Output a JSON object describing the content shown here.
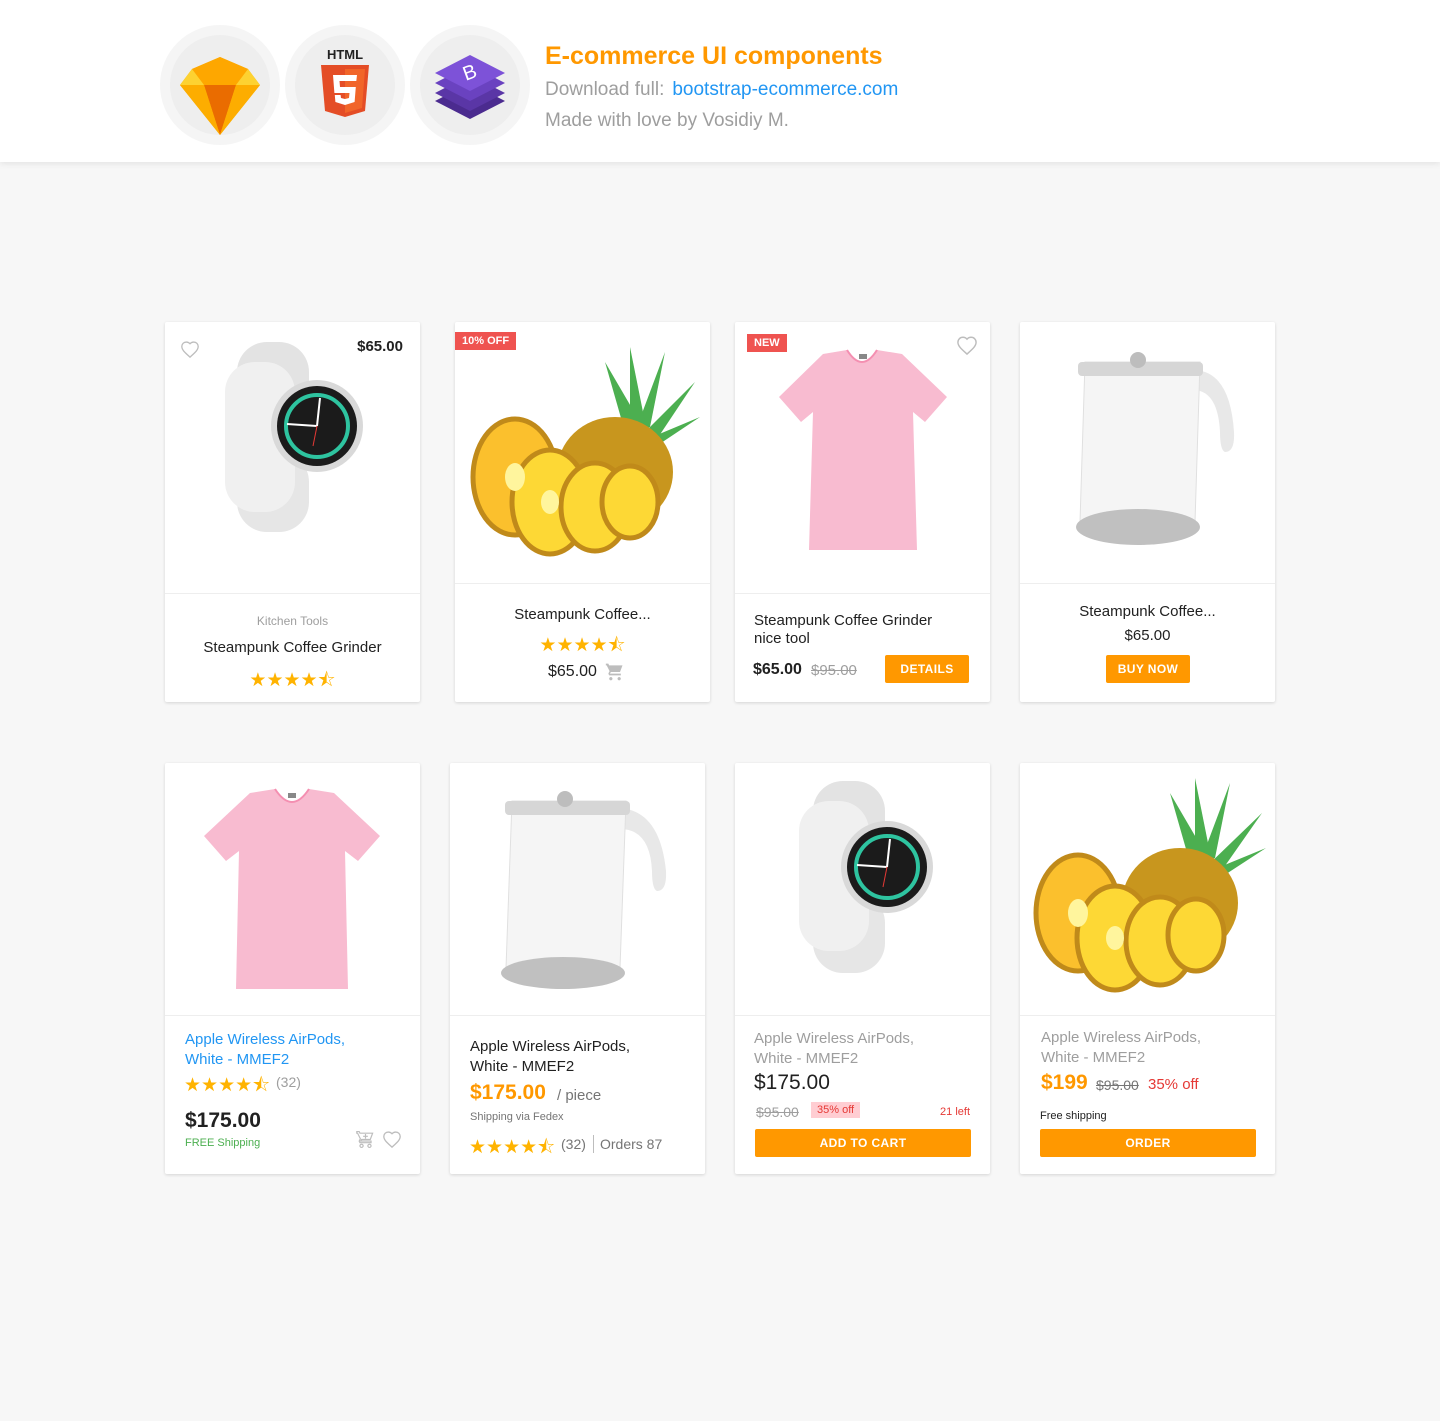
{
  "header": {
    "title": "E-commerce UI components",
    "download_label": "Download full:",
    "download_link": "bootstrap-ecommerce.com",
    "made_by": "Made with love by  Vosidiy M.",
    "html5_text": "HTML",
    "bootstrap_letter": "B"
  },
  "colors": {
    "accent": "#ff9800",
    "link": "#2196f3",
    "badge": "#ef5350",
    "star": "#ffb300",
    "success": "#4caf50",
    "danger": "#e53935"
  },
  "row1": [
    {
      "price": "$65.00",
      "category": "Kitchen Tools",
      "name": "Steampunk Coffee Grinder",
      "rating": 4.5,
      "stars": "★★★★⯪"
    },
    {
      "badge": "10% OFF",
      "name": "Steampunk Coffee...",
      "rating": 4.5,
      "stars": "★★★★⯪",
      "price": "$65.00"
    },
    {
      "badge": "NEW",
      "name_line1": "Steampunk Coffee Grinder",
      "name_line2": "nice tool",
      "price": "$65.00",
      "old_price": "$95.00",
      "button": "DETAILS"
    },
    {
      "name": "Steampunk Coffee...",
      "price": "$65.00",
      "button": "BUY NOW"
    }
  ],
  "row2": [
    {
      "name_line1": "Apple Wireless AirPods,",
      "name_line2": "White - MMEF2",
      "stars": "★★★★⯪",
      "rating": 4.5,
      "reviews": "(32)",
      "price": "$175.00",
      "shipping": "FREE Shipping"
    },
    {
      "name_line1": "Apple Wireless AirPods,",
      "name_line2": "White - MMEF2",
      "price": "$175.00",
      "unit": "/ piece",
      "shipping": "Shipping via Fedex",
      "stars": "★★★★⯪",
      "rating": 4.5,
      "reviews": "(32)",
      "orders": "Orders 87"
    },
    {
      "name_line1": "Apple Wireless AirPods,",
      "name_line2": "White - MMEF2",
      "price": "$175.00",
      "old_price": "$95.00",
      "discount": "35% off",
      "stock": "21 left",
      "button": "ADD TO CART"
    },
    {
      "name_line1": "Apple Wireless AirPods,",
      "name_line2": "White - MMEF2",
      "price": "$199",
      "old_price": "$95.00",
      "discount": "35% off",
      "shipping": "Free shipping",
      "button": "ORDER"
    }
  ]
}
